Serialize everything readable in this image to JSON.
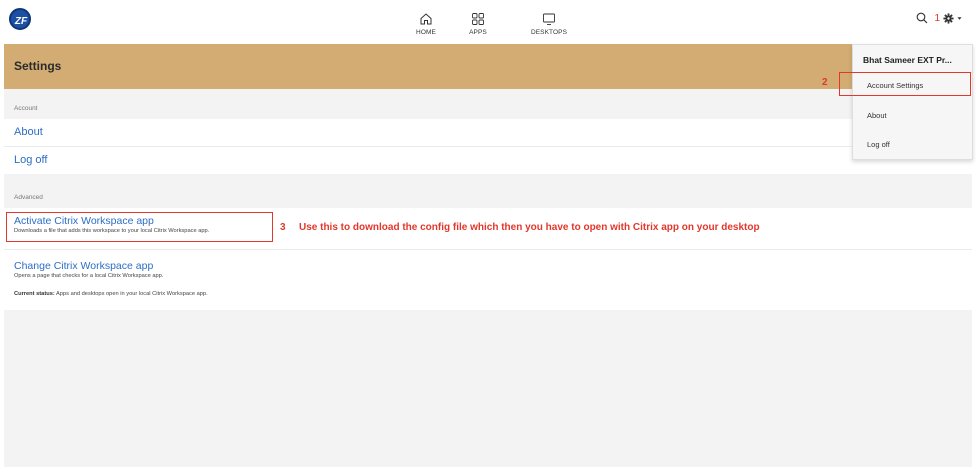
{
  "header": {
    "logo_text": "ZF",
    "nav": [
      {
        "label": "HOME",
        "icon": "home-icon"
      },
      {
        "label": "APPS",
        "icon": "apps-grid-icon"
      },
      {
        "label": "DESKTOPS",
        "icon": "desktop-monitor-icon"
      }
    ],
    "annotation_1": "1",
    "search_icon": "search-icon",
    "gear_icon": "gear-icon"
  },
  "settings": {
    "title": "Settings"
  },
  "account_section": {
    "label": "Account",
    "items": [
      "About",
      "Log off"
    ]
  },
  "advanced_section": {
    "label": "Advanced",
    "activate": {
      "title": "Activate Citrix Workspace app",
      "description": "Downloads a file that adds this workspace to your local Citrix Workspace app."
    },
    "change": {
      "title": "Change Citrix Workspace app",
      "description": "Opens a page that checks for a local Citrix Workspace app.",
      "status_label": "Current status:",
      "status_value": " Apps and desktops open in your local Citrix Workspace app."
    }
  },
  "annotations": {
    "num_2": "2",
    "num_3": "3",
    "note_3": "Use this to download the config file which then you have to open with Citrix app on your desktop",
    "color": "#e2372b"
  },
  "dropdown": {
    "user": "Bhat Sameer EXT Pr...",
    "items": [
      "Account Settings",
      "About",
      "Log off"
    ]
  },
  "colors": {
    "settings_bar": "#d2ac72",
    "link": "#2c6ec4",
    "section_bg": "#f3f3f3"
  }
}
